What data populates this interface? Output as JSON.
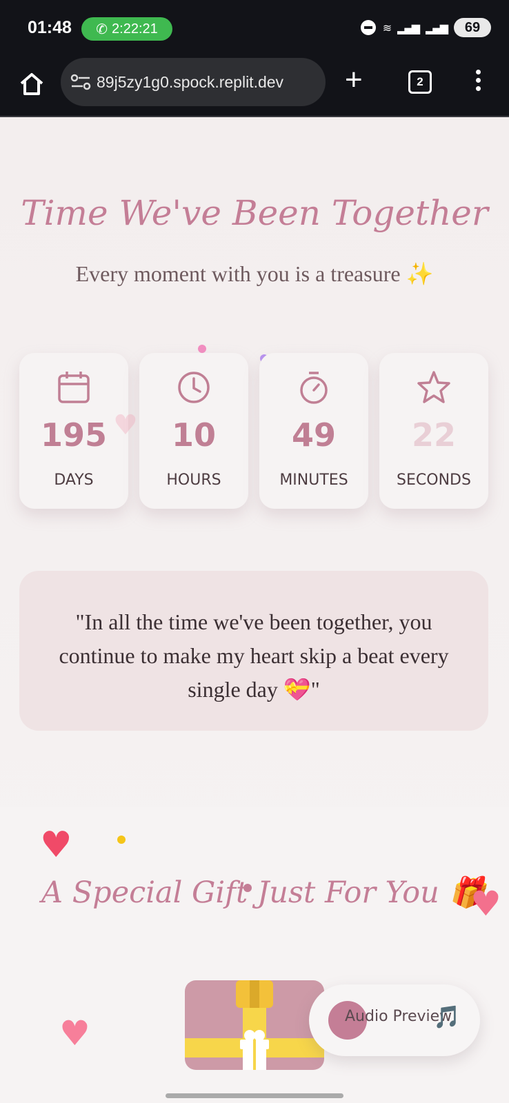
{
  "status_bar": {
    "time": "01:48",
    "call_timer": "2:22:21",
    "battery": "69",
    "accent": "#3fb950"
  },
  "browser": {
    "url": "89j5zy1g0.spock.replit.dev",
    "tab_count": "2"
  },
  "hero": {
    "title": "Time We've Been Together",
    "subtitle": "Every moment with you is a treasure ✨"
  },
  "counters": [
    {
      "icon": "calendar-icon",
      "value": "195",
      "label": "DAYS"
    },
    {
      "icon": "clock-icon",
      "value": "10",
      "label": "HOURS"
    },
    {
      "icon": "stopwatch-icon",
      "value": "49",
      "label": "MINUTES"
    },
    {
      "icon": "star-icon",
      "value": "22",
      "label": "SECONDS"
    }
  ],
  "quote": {
    "text": "\"In all the time we've been together, you continue to make my heart skip a beat every single day 💝\""
  },
  "gift": {
    "title": "A Special Gift Just For You 🎁"
  },
  "audio": {
    "label": "Audio Preview",
    "note": "🎵"
  },
  "colors": {
    "accent": "#c47e96",
    "background": "#f3eeee"
  }
}
